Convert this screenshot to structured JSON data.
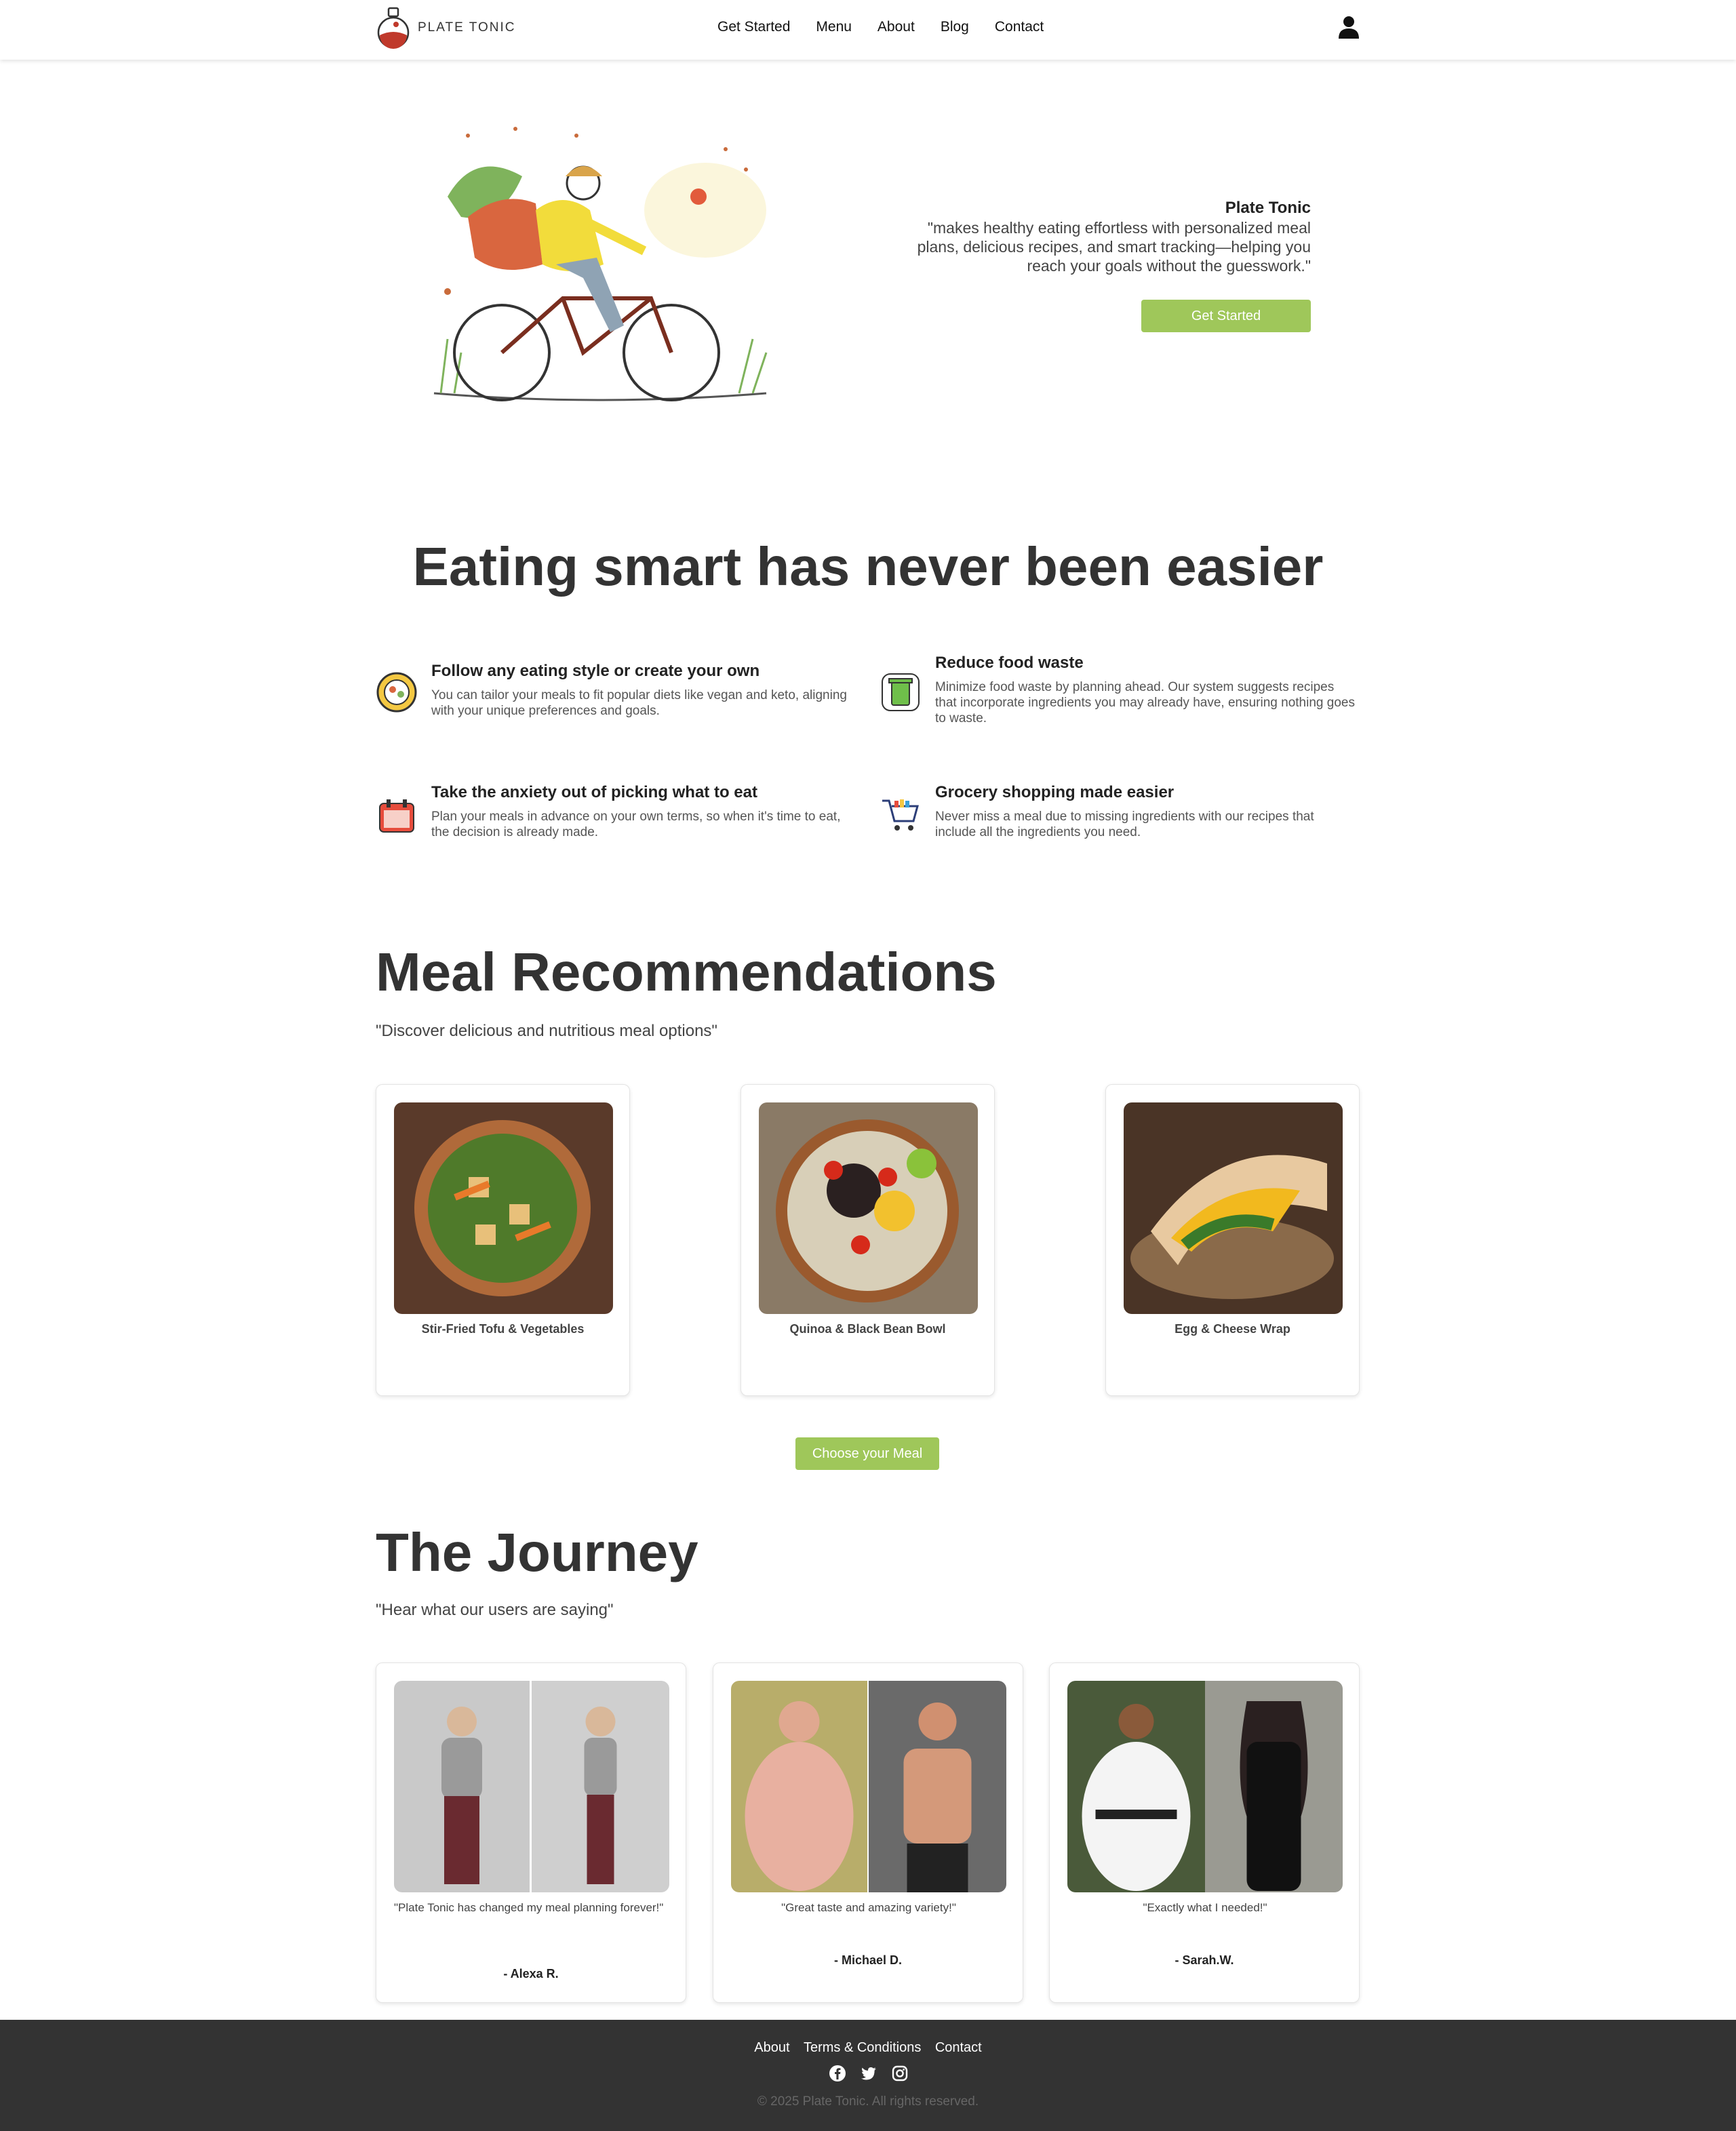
{
  "brand": {
    "name": "PLATE TONIC"
  },
  "nav": {
    "items": [
      "Get Started",
      "Menu",
      "About",
      "Blog",
      "Contact"
    ]
  },
  "hero": {
    "brand": "Plate Tonic",
    "quote": "\"makes healthy eating effortless with personalized meal plans, delicious recipes, and smart tracking—helping you reach your goals without the guesswork.\"",
    "button": "Get Started"
  },
  "features": {
    "title": "Eating smart has never been easier",
    "items": [
      {
        "icon": "diet-plate-icon",
        "title": "Follow any eating style or create your own",
        "text": "You can tailor your meals to fit popular diets like vegan and keto, aligning with your unique preferences and goals."
      },
      {
        "icon": "recycle-bin-icon",
        "title": "Reduce food waste",
        "text": "Minimize food waste by planning ahead. Our system suggests recipes that incorporate ingredients you may already have, ensuring nothing goes to waste."
      },
      {
        "icon": "calendar-icon",
        "title": "Take the anxiety out of picking what to eat",
        "text": "Plan your meals in advance on your own terms, so when it's time to eat, the decision is already made."
      },
      {
        "icon": "shopping-cart-icon",
        "title": "Grocery shopping made easier",
        "text": "Never miss a meal due to missing ingredients with our recipes that include all the ingredients you need."
      }
    ]
  },
  "meals": {
    "title": "Meal Recommendations",
    "subtitle": "\"Discover delicious and nutritious meal options\"",
    "items": [
      {
        "name": "Stir-Fried Tofu & Vegetables"
      },
      {
        "name": "Quinoa & Black Bean Bowl"
      },
      {
        "name": "Egg & Cheese Wrap"
      }
    ],
    "button": "Choose your Meal"
  },
  "journey": {
    "title": "The Journey",
    "subtitle": "\"Hear what our users are saying\"",
    "items": [
      {
        "quote": "\"Plate Tonic has changed my meal planning forever!\"",
        "name": "- Alexa R."
      },
      {
        "quote": "\"Great taste and amazing variety!\"",
        "name": "- Michael D."
      },
      {
        "quote": "\"Exactly what I needed!\"",
        "name": "- Sarah.W."
      }
    ]
  },
  "footer": {
    "links": [
      "About",
      "Terms & Conditions",
      "Contact"
    ],
    "socials": [
      "facebook-icon",
      "twitter-icon",
      "instagram-icon"
    ],
    "copyright": "© 2025 Plate Tonic. All rights reserved."
  },
  "colors": {
    "accent": "#9fc75a",
    "footer": "#333333",
    "logo_red": "#c0392b"
  }
}
